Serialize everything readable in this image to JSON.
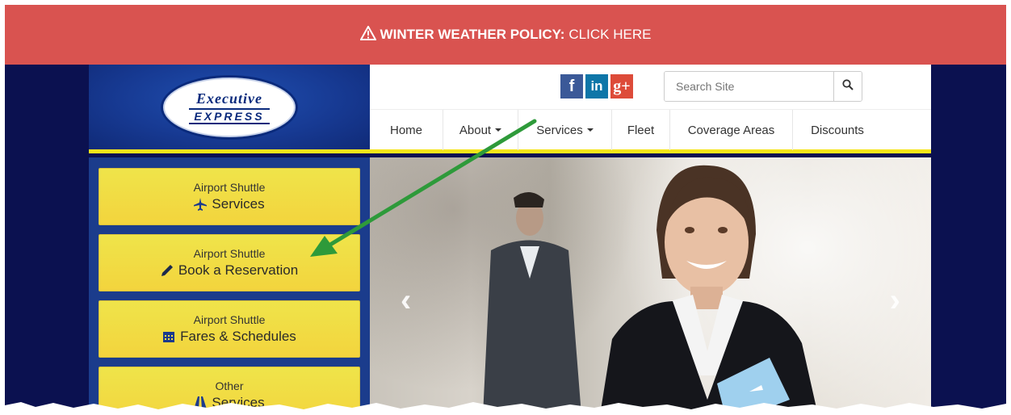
{
  "alert": {
    "icon": "warning-triangle-icon",
    "bold_text": "WINTER WEATHER POLICY:",
    "link_text": "CLICK HERE",
    "color": "#d95350"
  },
  "logo": {
    "line1": "Executive",
    "line2": "EXPRESS"
  },
  "social": [
    {
      "name": "facebook-icon",
      "glyph": "f"
    },
    {
      "name": "linkedin-icon",
      "glyph": "in"
    },
    {
      "name": "google-plus-icon",
      "glyph": "g+"
    }
  ],
  "search": {
    "placeholder": "Search Site",
    "icon": "search-icon"
  },
  "nav": {
    "items": [
      {
        "label": "Home",
        "dropdown": false
      },
      {
        "label": "About",
        "dropdown": true
      },
      {
        "label": "Services",
        "dropdown": true
      },
      {
        "label": "Fleet",
        "dropdown": false
      },
      {
        "label": "Coverage Areas",
        "dropdown": false
      },
      {
        "label": "Discounts",
        "dropdown": false
      }
    ]
  },
  "sidebar": {
    "buttons": [
      {
        "small": "Airport Shuttle",
        "big": "Services",
        "icon": "airplane-icon"
      },
      {
        "small": "Airport Shuttle",
        "big": "Book a Reservation",
        "icon": "pencil-icon"
      },
      {
        "small": "Airport Shuttle",
        "big": "Fares & Schedules",
        "icon": "calendar-icon"
      },
      {
        "small": "Other",
        "big": "Services",
        "icon": "road-icon"
      }
    ]
  },
  "slider": {
    "prev_icon": "chevron-left-icon",
    "next_icon": "chevron-right-icon"
  },
  "colors": {
    "navy": "#0b1150",
    "yellow": "#f5e51a",
    "sidebar_blue": "#1b3c8c",
    "annotation_arrow": "#2e9a3a"
  }
}
